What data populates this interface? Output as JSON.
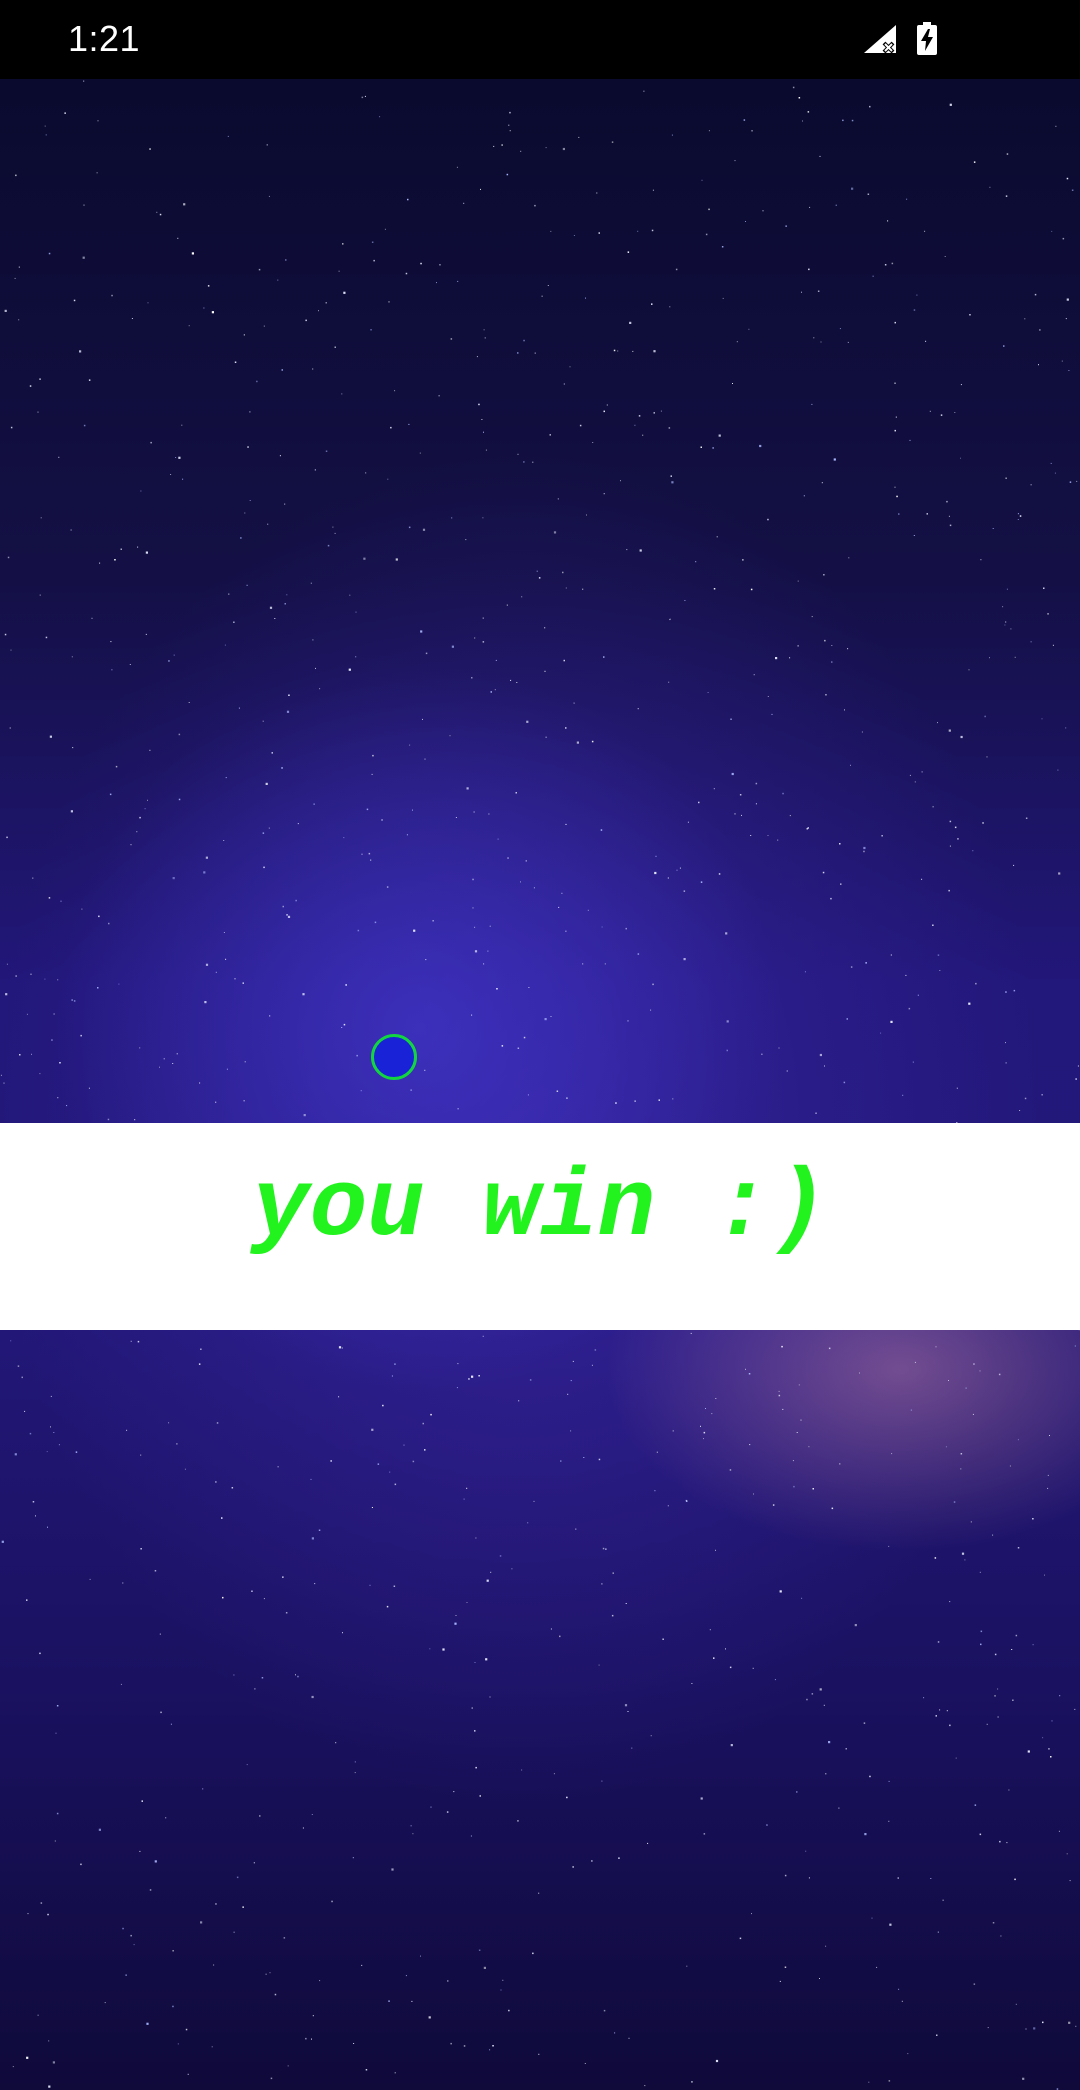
{
  "status_bar": {
    "time": "1:21",
    "icons": [
      "signal-no-service-icon",
      "battery-charging-icon"
    ]
  },
  "game": {
    "background": "night-sky-starfield",
    "result_message": "you win :)",
    "colors": {
      "message": "#22f21e",
      "banner": "#ffffff",
      "ball_fill": "#1a22d8",
      "ball_outline": "#12d640"
    }
  }
}
